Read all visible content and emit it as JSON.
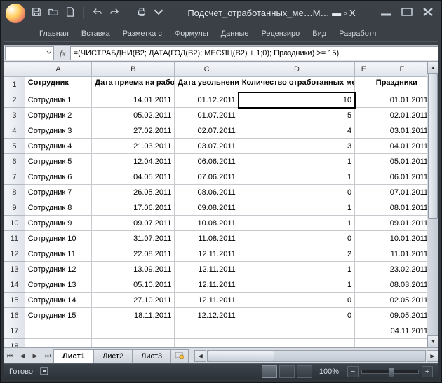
{
  "title": "Подсчет_отработанных_ме…M… ▬  ▫  X",
  "ribbon": {
    "tabs": [
      "Главная",
      "Вставка",
      "Разметка с",
      "Формулы",
      "Данные",
      "Рецензиро",
      "Вид",
      "Разработч"
    ]
  },
  "namebox": "",
  "formula": "=(ЧИСТРАБДНИ(B2; ДАТА(ГОД(B2); МЕСЯЦ(B2) + 1;0); Праздники) >= 15)",
  "columns": [
    "A",
    "B",
    "C",
    "D",
    "E",
    "F"
  ],
  "headers": {
    "A": "Сотрудник",
    "B": "Дата приема на работу",
    "C": "Дата увольнения",
    "D": "Количество отработанных месяцев",
    "E": "",
    "F": "Праздники"
  },
  "rows": [
    {
      "n": 2,
      "A": "Сотрудник 1",
      "B": "14.01.2011",
      "C": "01.12.2011",
      "D": "10",
      "F": "01.01.2011"
    },
    {
      "n": 3,
      "A": "Сотрудник 2",
      "B": "05.02.2011",
      "C": "01.07.2011",
      "D": "5",
      "F": "02.01.2011"
    },
    {
      "n": 4,
      "A": "Сотрудник 3",
      "B": "27.02.2011",
      "C": "02.07.2011",
      "D": "4",
      "F": "03.01.2011"
    },
    {
      "n": 5,
      "A": "Сотрудник 4",
      "B": "21.03.2011",
      "C": "03.07.2011",
      "D": "3",
      "F": "04.01.2011"
    },
    {
      "n": 6,
      "A": "Сотрудник 5",
      "B": "12.04.2011",
      "C": "06.06.2011",
      "D": "1",
      "F": "05.01.2011"
    },
    {
      "n": 7,
      "A": "Сотрудник 6",
      "B": "04.05.2011",
      "C": "07.06.2011",
      "D": "1",
      "F": "06.01.2011"
    },
    {
      "n": 8,
      "A": "Сотрудник 7",
      "B": "26.05.2011",
      "C": "08.06.2011",
      "D": "0",
      "F": "07.01.2011"
    },
    {
      "n": 9,
      "A": "Сотрудник 8",
      "B": "17.06.2011",
      "C": "09.08.2011",
      "D": "1",
      "F": "08.01.2011"
    },
    {
      "n": 10,
      "A": "Сотрудник 9",
      "B": "09.07.2011",
      "C": "10.08.2011",
      "D": "1",
      "F": "09.01.2011"
    },
    {
      "n": 11,
      "A": "Сотрудник 10",
      "B": "31.07.2011",
      "C": "11.08.2011",
      "D": "0",
      "F": "10.01.2011"
    },
    {
      "n": 12,
      "A": "Сотрудник 11",
      "B": "22.08.2011",
      "C": "12.11.2011",
      "D": "2",
      "F": "11.01.2011"
    },
    {
      "n": 13,
      "A": "Сотрудник 12",
      "B": "13.09.2011",
      "C": "12.11.2011",
      "D": "1",
      "F": "23.02.2011"
    },
    {
      "n": 14,
      "A": "Сотрудник 13",
      "B": "05.10.2011",
      "C": "12.11.2011",
      "D": "1",
      "F": "08.03.2011"
    },
    {
      "n": 15,
      "A": "Сотрудник 14",
      "B": "27.10.2011",
      "C": "12.11.2011",
      "D": "0",
      "F": "02.05.2011"
    },
    {
      "n": 16,
      "A": "Сотрудник 15",
      "B": "18.11.2011",
      "C": "12.12.2011",
      "D": "0",
      "F": "09.05.2011"
    },
    {
      "n": 17,
      "A": "",
      "B": "",
      "C": "",
      "D": "",
      "F": "04.11.2011"
    },
    {
      "n": 18,
      "A": "",
      "B": "",
      "C": "",
      "D": "",
      "F": ""
    }
  ],
  "active_cell": "D2",
  "sheets": {
    "tabs": [
      "Лист1",
      "Лист2",
      "Лист3"
    ],
    "active": 0
  },
  "status": {
    "ready": "Готово",
    "zoom": "100%"
  }
}
